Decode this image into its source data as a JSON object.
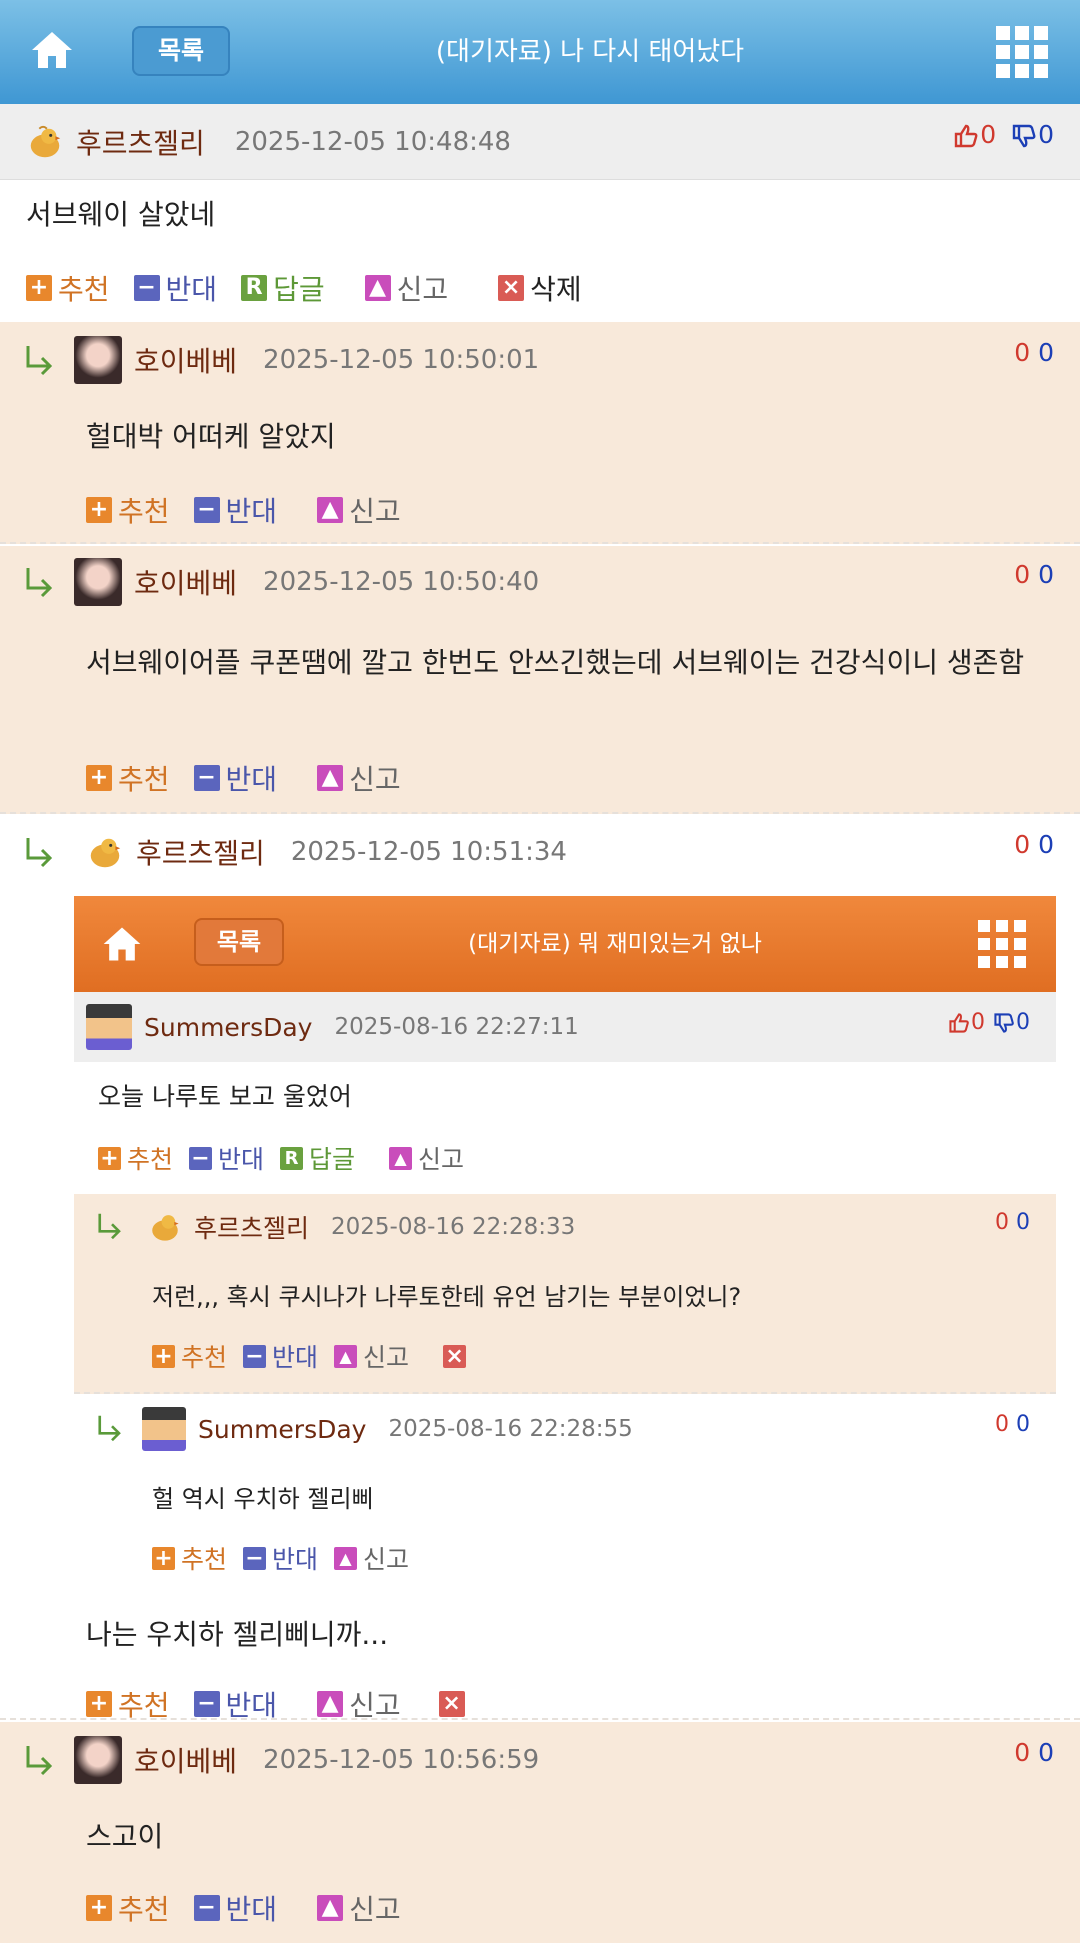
{
  "topbar": {
    "list_label": "목록",
    "title": "(대기자료) 나 다시 태어났다"
  },
  "post": {
    "nick": "후르츠젤리",
    "date": "2025-12-05 10:48:48",
    "up": "0",
    "down": "0",
    "body": "서브웨이 살았네"
  },
  "actions": {
    "recommend": "추천",
    "oppose": "반대",
    "reply": "답글",
    "report": "신고",
    "delete": "삭제"
  },
  "comments": [
    {
      "nick": "호이베베",
      "date": "2025-12-05 10:50:01",
      "up": "0",
      "down": "0",
      "body": "헐대박 어떠케 알았지"
    },
    {
      "nick": "호이베베",
      "date": "2025-12-05 10:50:40",
      "up": "0",
      "down": "0",
      "body": "서브웨이어플 쿠폰땜에 깔고 한번도 안쓰긴했는데 서브웨이는 건강식이니 생존함"
    },
    {
      "nick": "후르츠젤리",
      "date": "2025-12-05 10:51:34",
      "up": "0",
      "down": "0",
      "body": "나는 우치하 젤리삐니까..."
    },
    {
      "nick": "호이베베",
      "date": "2025-12-05 10:56:59",
      "up": "0",
      "down": "0",
      "body": "스고이"
    }
  ],
  "embed": {
    "list_label": "목록",
    "title": "(대기자료) 뭐 재미있는거 없나",
    "post": {
      "nick": "SummersDay",
      "date": "2025-08-16 22:27:11",
      "up": "0",
      "down": "0",
      "body": "오늘 나루토 보고 울었어"
    },
    "comments": [
      {
        "nick": "후르츠젤리",
        "date": "2025-08-16 22:28:33",
        "up": "0",
        "down": "0",
        "body": "저런,,, 혹시 쿠시나가 나루토한테 유언 남기는 부분이었니?"
      },
      {
        "nick": "SummersDay",
        "date": "2025-08-16 22:28:55",
        "up": "0",
        "down": "0",
        "body": "헐 역시 우치하 젤리삐"
      }
    ]
  },
  "colors": {
    "header": "#4fa3da",
    "embed_header": "#e87a2c",
    "peach": "#f8e9da"
  },
  "icons": [
    "home-icon",
    "grid-menu-icon",
    "thumbs-up-icon",
    "thumbs-down-icon",
    "reply-arrow-icon",
    "chick-avatar",
    "pixel-avatar"
  ]
}
